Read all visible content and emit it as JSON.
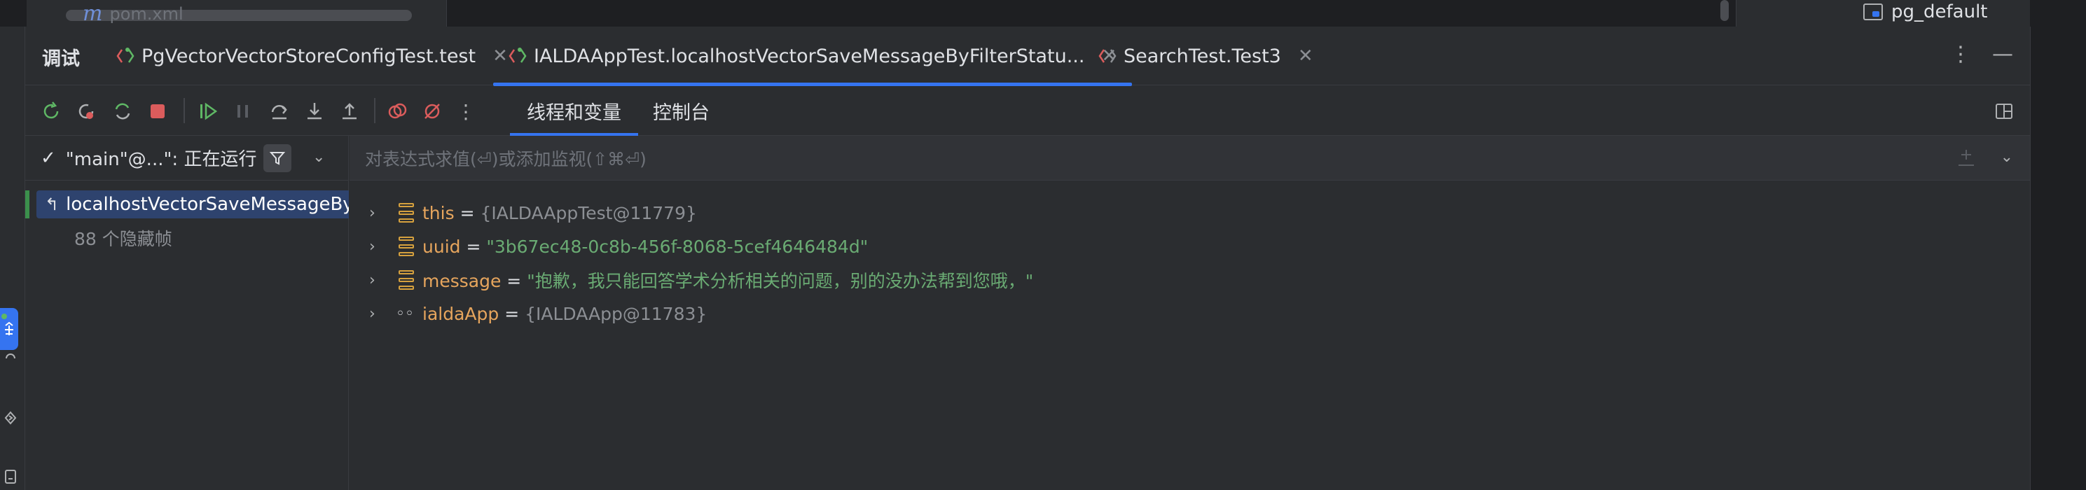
{
  "top": {
    "file_name": "pom.xml",
    "file_icon": "m",
    "datasource": "pg_default"
  },
  "debug": {
    "title": "调试",
    "tabs": [
      {
        "label": "PgVectorVectorStoreConfigTest.test",
        "active": false
      },
      {
        "label": "IALDAAppTest.localhostVectorSaveMessageByFilterStatu...",
        "active": true
      },
      {
        "label": "SearchTest.Test3",
        "active": false
      }
    ],
    "close_glyph": "✕",
    "more_glyph": "⋮",
    "minimize_glyph": "—",
    "subtabs": [
      {
        "label": "线程和变量",
        "active": true
      },
      {
        "label": "控制台",
        "active": false
      }
    ]
  },
  "frames": {
    "thread_label": "\"main\"@...\": 正在运行",
    "selected_frame": "localhostVectorSaveMessageByFilterStatus",
    "hidden_frames": "88 个隐藏帧"
  },
  "variables": {
    "eval_placeholder": "对表达式求值(⏎)或添加监视(⇧⌘⏎)",
    "items": [
      {
        "name": "this",
        "eq": " = ",
        "value": "{IALDAAppTest@11779}",
        "kind": "obj",
        "icon": "field-icon"
      },
      {
        "name": "uuid",
        "eq": " = ",
        "value": "\"3b67ec48-0c8b-456f-8068-5cef4646484d\"",
        "kind": "str",
        "icon": "field-icon"
      },
      {
        "name": "message",
        "eq": " = ",
        "value": "\"抱歉，我只能回答学术分析相关的问题，别的没办法帮到您哦，\"",
        "kind": "str",
        "icon": "field-icon"
      },
      {
        "name": "ialdaApp",
        "eq": " = ",
        "value": "{IALDAApp@11783}",
        "kind": "obj",
        "icon": "watch-icon"
      }
    ]
  },
  "colors": {
    "accent": "#3574f0",
    "panel": "#2b2d30",
    "string": "#6aab73",
    "field_name": "#e6a55d",
    "stop": "#db5c5c",
    "resume": "#5fb865"
  }
}
